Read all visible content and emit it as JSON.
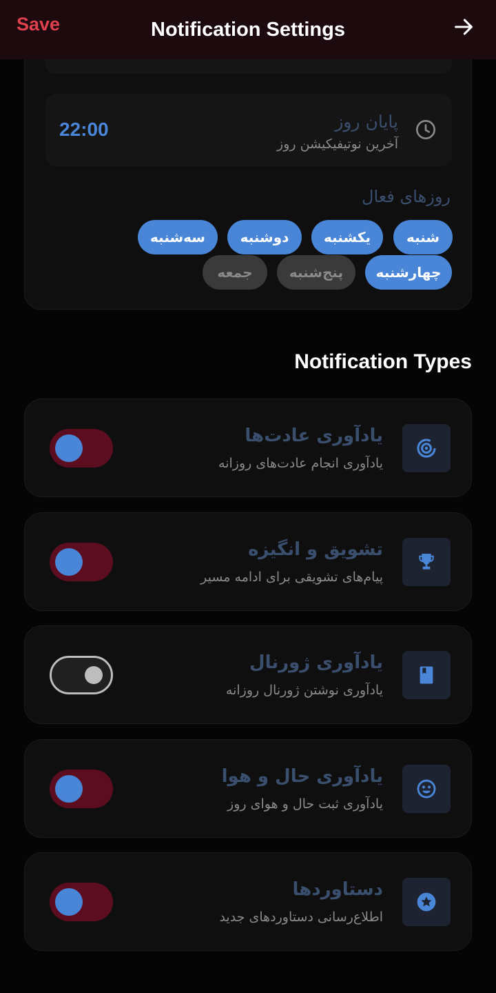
{
  "header": {
    "save_label": "Save",
    "title": "Notification Settings",
    "back_icon": "arrow-right-icon"
  },
  "schedule": {
    "end_time": "22:00",
    "end_label": "پایان روز",
    "end_sub": "آخرین نوتیفیکیشن روز",
    "end_icon": "clock-icon",
    "active_days_label": "روزهای فعال",
    "days": [
      {
        "label": "شنبه",
        "active": true
      },
      {
        "label": "یکشنبه",
        "active": true
      },
      {
        "label": "دوشنبه",
        "active": true
      },
      {
        "label": "سه‌شنبه",
        "active": true
      },
      {
        "label": "چهارشنبه",
        "active": true
      },
      {
        "label": "پنج‌شنبه",
        "active": false
      },
      {
        "label": "جمعه",
        "active": false
      }
    ]
  },
  "types": {
    "section_title": "Notification Types",
    "items": [
      {
        "title": "یادآوری عادت‌ها",
        "sub": "یادآوری انجام عادت‌های روزانه",
        "icon": "target-icon",
        "enabled": true
      },
      {
        "title": "تشویق و انگیزه",
        "sub": "پیام‌های تشویقی برای ادامه مسیر",
        "icon": "trophy-icon",
        "enabled": true
      },
      {
        "title": "یادآوری ژورنال",
        "sub": "یادآوری نوشتن ژورنال روزانه",
        "icon": "book-icon",
        "enabled": false
      },
      {
        "title": "یادآوری حال و هوا",
        "sub": "یادآوری ثبت حال و هوای روز",
        "icon": "smiley-icon",
        "enabled": true
      },
      {
        "title": "دستاوردها",
        "sub": "اطلاع‌رسانی دستاوردهای جدید",
        "icon": "star-badge-icon",
        "enabled": true
      }
    ]
  },
  "colors": {
    "accent": "#4a86d8",
    "danger": "#e0404e",
    "toggle_on_track": "#5c0d20"
  }
}
